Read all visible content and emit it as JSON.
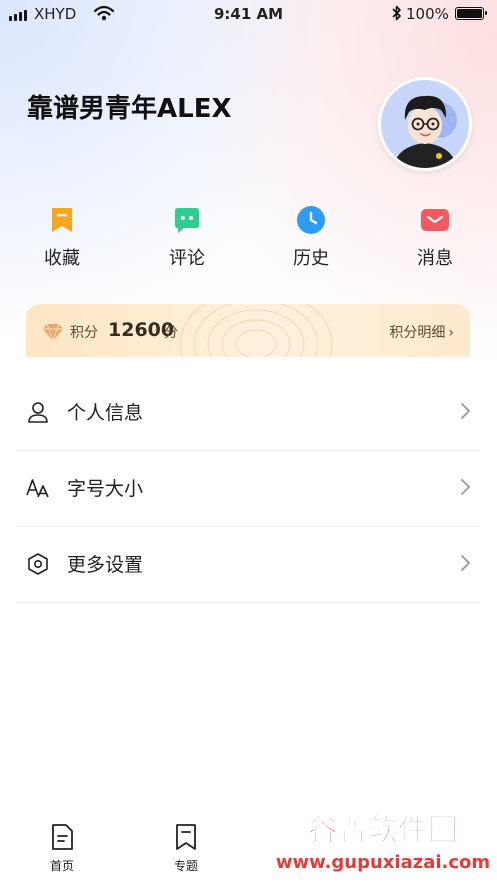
{
  "status_bar": {
    "carrier": "XHYD",
    "time": "9:41 AM",
    "battery": "100%"
  },
  "profile": {
    "username": "靠谱男青年ALEX",
    "avatar": "avatar-cartoon-man"
  },
  "quick_actions": [
    {
      "label": "收藏",
      "icon": "bookmark-icon",
      "color": "#f6a623"
    },
    {
      "label": "评论",
      "icon": "comment-icon",
      "color": "#2ccf8f"
    },
    {
      "label": "历史",
      "icon": "clock-icon",
      "color": "#2e9cf5"
    },
    {
      "label": "消息",
      "icon": "mail-icon",
      "color": "#f25a62"
    }
  ],
  "points": {
    "label": "积分",
    "value": "12600",
    "unit": "分",
    "detail": "积分明细"
  },
  "menu": [
    {
      "label": "个人信息",
      "icon": "user-icon"
    },
    {
      "label": "字号大小",
      "icon": "font-size-icon"
    },
    {
      "label": "更多设置",
      "icon": "hexagon-settings-icon"
    }
  ],
  "tabs": [
    {
      "label": "首页",
      "icon": "document-icon"
    },
    {
      "label": "专题",
      "icon": "bookmark-outline-icon"
    }
  ],
  "watermark": {
    "title": "谷普软件园",
    "url": "www.gupuxiazai.com"
  }
}
